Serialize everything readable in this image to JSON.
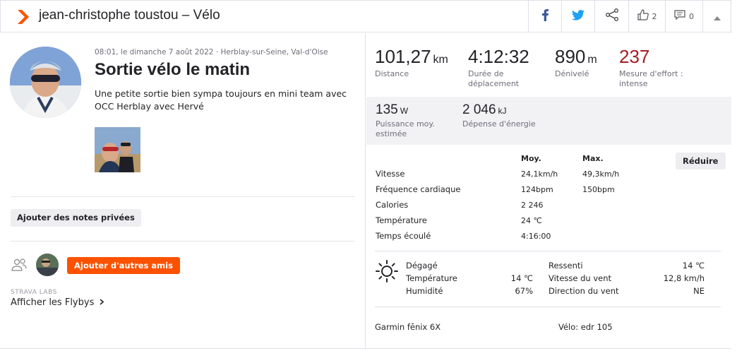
{
  "header": {
    "title": "jean-christophe toustou – Vélo",
    "kudos_count": "2",
    "comments_count": "0"
  },
  "activity": {
    "meta": "08:01, le dimanche 7 août 2022 · Herblay-sur-Seine, Val-d'Oise",
    "title": "Sortie vélo le matin",
    "description": "Une petite sortie bien sympa toujours en mini team avec OCC Herblay avec Hervé",
    "private_notes_button": "Ajouter des notes privées",
    "add_friends_button": "Ajouter d'autres amis",
    "labs_label": "STRAVA LABS",
    "flybys_link": "Afficher les Flybys"
  },
  "stats": {
    "distance": {
      "value": "101,27",
      "unit": "km",
      "label": "Distance"
    },
    "moving_time": {
      "value": "4:12:32",
      "label": "Durée de déplacement"
    },
    "elevation": {
      "value": "890",
      "unit": "m",
      "label": "Dénivelé"
    },
    "effort": {
      "value": "237",
      "label": "Mesure d'effort : intense"
    },
    "power": {
      "value": "135",
      "unit": "W",
      "label": "Puissance moy. estimée"
    },
    "energy": {
      "value": "2 046",
      "unit": "kJ",
      "label": "Dépense d'énergie"
    }
  },
  "details": {
    "avg_header": "Moy.",
    "max_header": "Max.",
    "reduce_button": "Réduire",
    "rows": [
      {
        "label": "Vitesse",
        "avg": "24,1km/h",
        "max": "49,3km/h"
      },
      {
        "label": "Fréquence cardiaque",
        "avg": "124bpm",
        "max": "150bpm"
      },
      {
        "label": "Calories",
        "avg": "2 246",
        "max": ""
      },
      {
        "label": "Température",
        "avg": "24 ℃",
        "max": ""
      },
      {
        "label": "Temps écoulé",
        "avg": "4:16:00",
        "max": ""
      }
    ]
  },
  "weather": {
    "condition": "Dégagé",
    "temp_label": "Température",
    "temp_value": "14 ℃",
    "humidity_label": "Humidité",
    "humidity_value": "67%",
    "feels_label": "Ressenti",
    "feels_value": "14 ℃",
    "wind_speed_label": "Vitesse du vent",
    "wind_speed_value": "12,8 km/h",
    "wind_dir_label": "Direction du vent",
    "wind_dir_value": "NE"
  },
  "gear": {
    "device": "Garmin fēnix 6X",
    "bike": "Vélo: edr 105"
  },
  "colors": {
    "brand_orange": "#fc5200",
    "effort_red": "#a31d23",
    "facebook": "#3b5998",
    "twitter": "#1da1f2"
  }
}
